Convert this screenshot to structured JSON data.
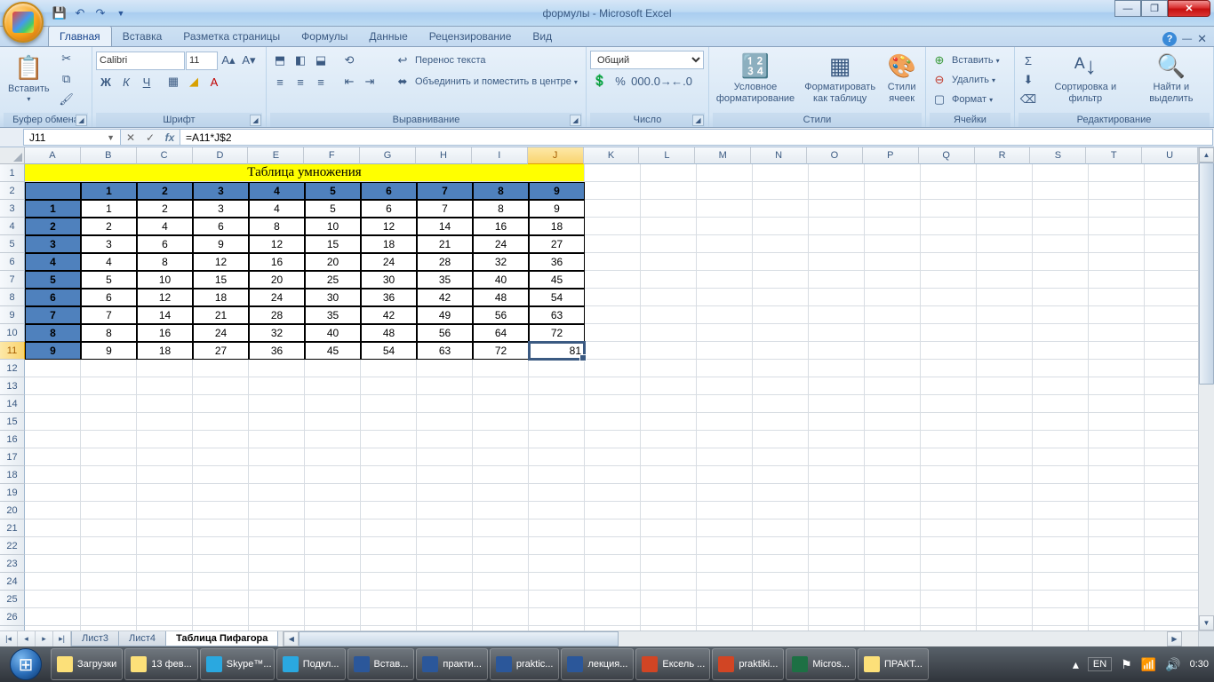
{
  "window": {
    "title": "формулы - Microsoft Excel"
  },
  "qat": [
    "💾",
    "↶",
    "↷"
  ],
  "tabs": {
    "items": [
      "Главная",
      "Вставка",
      "Разметка страницы",
      "Формулы",
      "Данные",
      "Рецензирование",
      "Вид"
    ],
    "active": 0
  },
  "ribbon": {
    "clipboard": {
      "label": "Буфер обмена",
      "paste": "Вставить"
    },
    "font": {
      "label": "Шрифт",
      "name": "Calibri",
      "size": "11"
    },
    "align": {
      "label": "Выравнивание",
      "wrap": "Перенос текста",
      "merge": "Объединить и поместить в центре"
    },
    "number": {
      "label": "Число",
      "format": "Общий"
    },
    "styles": {
      "label": "Стили",
      "cond": "Условное форматирование",
      "table": "Форматировать как таблицу",
      "cell": "Стили ячеек"
    },
    "cells": {
      "label": "Ячейки",
      "insert": "Вставить",
      "delete": "Удалить",
      "format": "Формат"
    },
    "editing": {
      "label": "Редактирование",
      "sort": "Сортировка и фильтр",
      "find": "Найти и выделить"
    }
  },
  "fbar": {
    "name": "J11",
    "formula": "=A11*J$2"
  },
  "sheet": {
    "cols": [
      "A",
      "B",
      "C",
      "D",
      "E",
      "F",
      "G",
      "H",
      "I",
      "J",
      "K",
      "L",
      "M",
      "N",
      "O",
      "P",
      "Q",
      "R",
      "S",
      "T",
      "U"
    ],
    "rows": 27,
    "selCol": 9,
    "selRow": 11,
    "title": "Таблица умножения",
    "headerRow": [
      "",
      "1",
      "2",
      "3",
      "4",
      "5",
      "6",
      "7",
      "8",
      "9"
    ],
    "body": [
      [
        "1",
        "1",
        "2",
        "3",
        "4",
        "5",
        "6",
        "7",
        "8",
        "9"
      ],
      [
        "2",
        "2",
        "4",
        "6",
        "8",
        "10",
        "12",
        "14",
        "16",
        "18"
      ],
      [
        "3",
        "3",
        "6",
        "9",
        "12",
        "15",
        "18",
        "21",
        "24",
        "27"
      ],
      [
        "4",
        "4",
        "8",
        "12",
        "16",
        "20",
        "24",
        "28",
        "32",
        "36"
      ],
      [
        "5",
        "5",
        "10",
        "15",
        "20",
        "25",
        "30",
        "35",
        "40",
        "45"
      ],
      [
        "6",
        "6",
        "12",
        "18",
        "24",
        "30",
        "36",
        "42",
        "48",
        "54"
      ],
      [
        "7",
        "7",
        "14",
        "21",
        "28",
        "35",
        "42",
        "49",
        "56",
        "63"
      ],
      [
        "8",
        "8",
        "16",
        "24",
        "32",
        "40",
        "48",
        "56",
        "64",
        "72"
      ],
      [
        "9",
        "9",
        "18",
        "27",
        "36",
        "45",
        "54",
        "63",
        "72",
        "81"
      ]
    ],
    "tabs": [
      "Лист3",
      "Лист4",
      "Таблица Пифагора"
    ],
    "activeTab": 2
  },
  "taskbar": {
    "items": [
      {
        "label": "Загрузки",
        "color": "#fce079"
      },
      {
        "label": "13 фев...",
        "color": "#fce079"
      },
      {
        "label": "Skype™...",
        "color": "#2aa8e0"
      },
      {
        "label": "Подкл...",
        "color": "#2aa8e0"
      },
      {
        "label": "Встав...",
        "color": "#2b579a"
      },
      {
        "label": "практи...",
        "color": "#2b579a"
      },
      {
        "label": "praktic...",
        "color": "#2b579a"
      },
      {
        "label": "лекция...",
        "color": "#2b579a"
      },
      {
        "label": "Ексель ...",
        "color": "#d14524"
      },
      {
        "label": "praktiki...",
        "color": "#d14524"
      },
      {
        "label": "Micros...",
        "color": "#1d7044"
      },
      {
        "label": "ПРАКТ...",
        "color": "#fce079"
      }
    ],
    "lang": "EN",
    "time": "0:30"
  }
}
